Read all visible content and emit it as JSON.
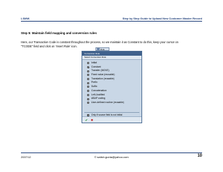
{
  "header": {
    "left": "LSMW",
    "right": "Step by Step Guide to Upload New Customer Master Record"
  },
  "step_title": "Step 5: Maintain field mapping and conversion rules",
  "body": {
    "line1": "Here, our Transaction Code is constant throughout the process, so we maintain it as Constant to do this, keep your cursor on",
    "line2": "“TCODE” field and click on ‘Insert Rule’ icon."
  },
  "rule_button": {
    "label": "Rule"
  },
  "dialog": {
    "title": "Conversion Rule",
    "subtitle": "Select Conversion Rule",
    "options": [
      "Initial",
      "Constant",
      "Transfer (MOVE)",
      "Fixed value (reusable)",
      "Translation (reusable)",
      "Prefix",
      "Suffix",
      "Concatenation",
      "Left-Justified",
      "ABAP coding",
      "User-defined routine (reusable)"
    ],
    "selected_option": "Constant",
    "checkbox_label": "Only if source field is not initial",
    "ok_icon": "✔",
    "cancel_icon": "✖"
  },
  "footer": {
    "left": "2007/12",
    "center": "© satish.gunta@yahoo.com",
    "page": "10"
  }
}
